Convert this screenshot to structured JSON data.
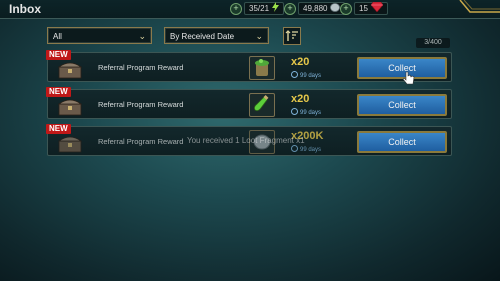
{
  "header": {
    "title": "Inbox"
  },
  "resources": {
    "energy": "35/21",
    "silver": "49,880",
    "gems": "15"
  },
  "filters": {
    "category": "All",
    "sort": "By Received Date"
  },
  "counter": "3/400",
  "rows": [
    {
      "badge": "NEW",
      "label": "Referral Program Reward",
      "qty": "x20",
      "days": "99 days",
      "button": "Collect"
    },
    {
      "badge": "NEW",
      "label": "Referral Program Reward",
      "qty": "x20",
      "days": "99 days",
      "button": "Collect"
    },
    {
      "badge": "NEW",
      "label": "Referral Program Reward",
      "qty": "x200K",
      "days": "99 days",
      "button": "Collect"
    }
  ],
  "toast": "You received 1 Loot Fragment x1",
  "colors": {
    "accent_gold": "#e6c84a",
    "button_blue": "#2a72b8",
    "badge_red": "#c01818"
  }
}
